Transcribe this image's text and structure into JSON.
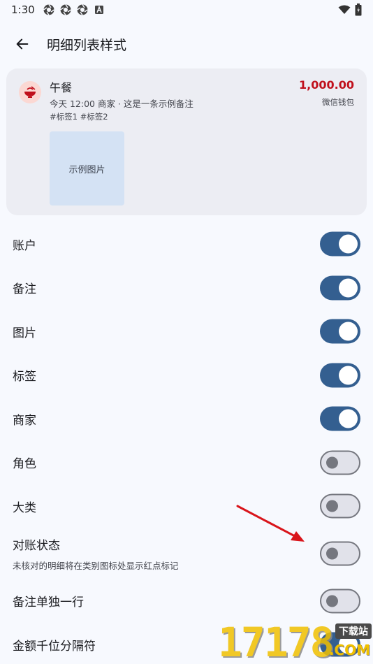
{
  "status": {
    "time": "1:30",
    "notification_icons": [
      "camera-shutter-icon",
      "camera-shutter-icon",
      "camera-shutter-icon",
      "a-box-icon"
    ],
    "right_icons": [
      "wifi-icon",
      "battery-icon"
    ]
  },
  "app_bar": {
    "title": "明细列表样式",
    "back_icon": "arrow-left-icon"
  },
  "preview": {
    "category_icon": "rice-bowl-icon",
    "category_color": "#c0101c",
    "title": "午餐",
    "subtitle": "今天 12:00 商家 · 这是一条示例备注",
    "tags": "#标签1 #标签2",
    "amount": "1,000.00",
    "amount_color": "#c0101c",
    "account": "微信钱包",
    "image_label": "示例图片"
  },
  "settings": [
    {
      "label": "账户",
      "enabled": true
    },
    {
      "label": "备注",
      "enabled": true
    },
    {
      "label": "图片",
      "enabled": true
    },
    {
      "label": "标签",
      "enabled": true
    },
    {
      "label": "商家",
      "enabled": true
    },
    {
      "label": "角色",
      "enabled": false
    },
    {
      "label": "大类",
      "enabled": false
    },
    {
      "label": "对账状态",
      "description": "未核对的明细将在类别图标处显示红点标记",
      "enabled": false
    },
    {
      "label": "备注单独一行",
      "enabled": false
    },
    {
      "label": "金额千位分隔符",
      "enabled": true
    }
  ],
  "colors": {
    "switch_on": "#345f90",
    "switch_off": "#e1e2ea",
    "background": "#f7f9fe",
    "card": "#ecedf3"
  },
  "watermark": {
    "digits": "17178",
    "badge": "下载站",
    "suffix": ".COM"
  }
}
